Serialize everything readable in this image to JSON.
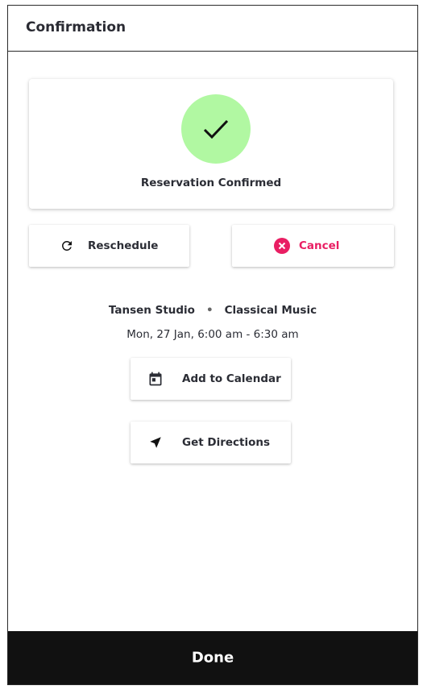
{
  "header": {
    "title": "Confirmation"
  },
  "status_card": {
    "icon": "checkmark-icon",
    "title": "Reservation Confirmed",
    "circle_color": "#b1f8a2"
  },
  "actions": {
    "reschedule_label": "Reschedule",
    "reschedule_icon": "refresh-icon",
    "cancel_label": "Cancel",
    "cancel_icon": "close-circle-icon",
    "cancel_color": "#e91e63"
  },
  "booking": {
    "venue": "Tansen Studio",
    "category": "Classical Music",
    "separator": "•",
    "datetime": "Mon, 27 Jan, 6:00 am - 6:30 am"
  },
  "links": {
    "calendar_label": "Add to Calendar",
    "calendar_icon": "calendar-icon",
    "directions_label": "Get Directions",
    "directions_icon": "navigation-arrow-icon"
  },
  "footer": {
    "done_label": "Done"
  }
}
